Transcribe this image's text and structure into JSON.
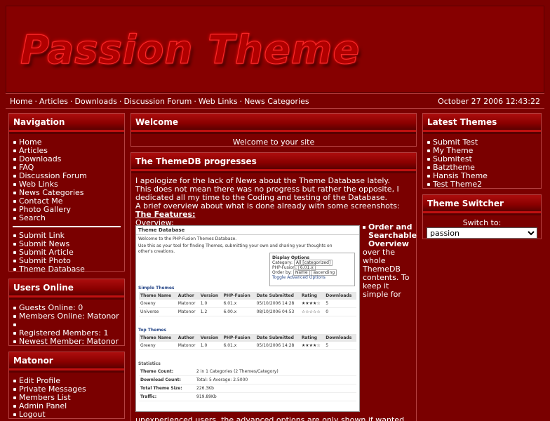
{
  "header": {
    "logo": "Passion Theme"
  },
  "subnav": {
    "links": [
      "Home",
      "Articles",
      "Downloads",
      "Discussion Forum",
      "Web Links",
      "News Categories"
    ],
    "datetime": "October 27 2006 12:43:22"
  },
  "navigation": {
    "title": "Navigation",
    "items": [
      "Home",
      "Articles",
      "Downloads",
      "FAQ",
      "Discussion Forum",
      "Web Links",
      "News Categories",
      "Contact Me",
      "Photo Gallery",
      "Search"
    ],
    "items2": [
      "Submit Link",
      "Submit News",
      "Submit Article",
      "Submit Photo",
      "Theme Database"
    ]
  },
  "users_online": {
    "title": "Users Online",
    "guests": "Guests Online: 0",
    "members": "Members Online: Matonor",
    "registered": "Registered Members: 1",
    "newest": "Newest Member: Matonor"
  },
  "user_panel": {
    "title": "Matonor",
    "items": [
      "Edit Profile",
      "Private Messages",
      "Members List",
      "Admin Panel",
      "Logout"
    ]
  },
  "welcome": {
    "title": "Welcome",
    "text": "Welcome to your site"
  },
  "news": {
    "title": "The ThemeDB progresses",
    "p1": "I apologize for the lack of News about the Theme Database lately.",
    "p2": "This does not mean there was no progress but rather the opposite, I",
    "p3": "dedicated all my time to the Coding and testing of the Database.",
    "p4": "A brief overview about what is done already with some screenshots:",
    "features": "The Features:",
    "overview": "Overview:",
    "side_bold": "Order and Searchable Overview",
    "side_text": "over the whole ThemeDB contents. To keep it simple for",
    "cut_text": "unexperienced users, the advanced options are only shown if wanted."
  },
  "screenshot": {
    "title": "Theme Database",
    "intro1": "Welcome to the PHP-Fusion Themes Database.",
    "intro2": "Use this as your tool for finding Themes, submitting your own and sharing your thoughts on other's creations.",
    "options_title": "Display Options",
    "category_label": "Category:",
    "category_value": "All [categorized]",
    "phpfusion_label": "PHP-Fusion:",
    "phpfusion_value": "6.01.x",
    "order_label": "Order by:",
    "order_value": "Name",
    "order_dir": "ascending",
    "toggle": "Toggle Advanced Options",
    "simple_title": "Simple Themes",
    "top_title": "Top Themes",
    "stats_title": "Statistics",
    "columns": [
      "Theme Name",
      "Author",
      "Version",
      "PHP-Fusion",
      "Date Submitted",
      "Rating",
      "Downloads"
    ],
    "simple_rows": [
      [
        "Greeny",
        "Matonor",
        "1.0",
        "6.01.x",
        "05/10/2006 14:28",
        "★★★★☆",
        "5"
      ],
      [
        "Universe",
        "Matonor",
        "1.2",
        "6.00.x",
        "08/10/2006 04:53",
        "☆☆☆☆☆",
        "0"
      ]
    ],
    "top_rows": [
      [
        "Greeny",
        "Matonor",
        "1.0",
        "6.01.x",
        "05/10/2006 14:28",
        "★★★★☆",
        "5"
      ]
    ],
    "stats": [
      [
        "Theme Count:",
        "2 in 1 Categories (2 Themes/Category)"
      ],
      [
        "Download Count:",
        "Total: 5 Average: 2.5000"
      ],
      [
        "Total Theme Size:",
        "226.3Kb"
      ],
      [
        "Traffic:",
        "919.89Kb"
      ]
    ]
  },
  "latest_themes": {
    "title": "Latest Themes",
    "items": [
      "Submit Test",
      "My Theme",
      "Submitest",
      "Batztheme",
      "Hansis Theme",
      "Test Theme2"
    ]
  },
  "theme_switcher": {
    "title": "Theme Switcher",
    "label": "Switch to:",
    "selected": "passion"
  }
}
